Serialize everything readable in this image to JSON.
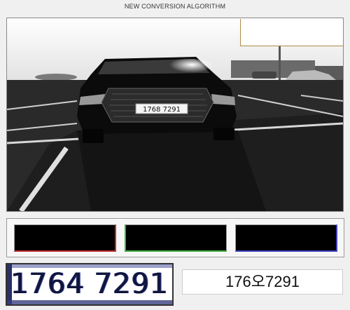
{
  "window": {
    "title": "NEW CONVERSION ALGORITHM"
  },
  "camera_view": {
    "plate_text": "1768 7291",
    "icon": "car-photo"
  },
  "channels": [
    "red-channel",
    "green-channel",
    "blue-channel"
  ],
  "plate_crop": {
    "text": "1764 7291"
  },
  "result": {
    "text": "176오7291"
  }
}
